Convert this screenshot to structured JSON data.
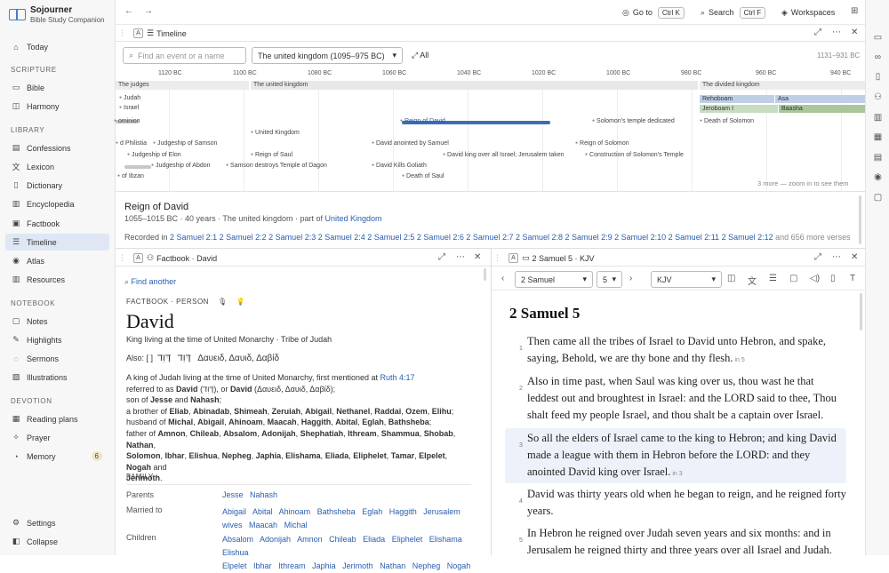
{
  "app": {
    "name": "Sojourner",
    "subtitle": "Bible Study Companion"
  },
  "topbar": {
    "goto_label": "Go to",
    "goto_kbd": "Ctrl K",
    "search_label": "Search",
    "search_kbd": "Ctrl F",
    "workspaces_label": "Workspaces"
  },
  "sidebar": {
    "today": "Today",
    "scripture_head": "SCRIPTURE",
    "bible": "Bible",
    "harmony": "Harmony",
    "library_head": "LIBRARY",
    "confessions": "Confessions",
    "lexicon": "Lexicon",
    "dictionary": "Dictionary",
    "encyclopedia": "Encyclopedia",
    "factbook": "Factbook",
    "timeline": "Timeline",
    "atlas": "Atlas",
    "resources": "Resources",
    "notebook_head": "NOTEBOOK",
    "notes": "Notes",
    "highlights": "Highlights",
    "sermons": "Sermons",
    "illustrations": "Illustrations",
    "devotion_head": "DEVOTION",
    "reading_plans": "Reading plans",
    "prayer": "Prayer",
    "memory": "Memory",
    "memory_count": "6",
    "settings": "Settings",
    "collapse": "Collapse"
  },
  "timeline": {
    "tab_letter": "A",
    "title": "Timeline",
    "search_placeholder": "Find an event or a name",
    "period_select": "The united kingdom (1095–975 BC)",
    "all_label": "All",
    "range": "1131–931 BC",
    "ticks": [
      "1120 BC",
      "1100 BC",
      "1080 BC",
      "1060 BC",
      "1040 BC",
      "1020 BC",
      "1000 BC",
      "980 BC",
      "960 BC",
      "940 BC"
    ],
    "bands": [
      "The judges",
      "The united kingdom",
      "The divided kingdom"
    ],
    "rows": [
      "Judah",
      "Israel"
    ],
    "kings": {
      "rehoboam": "Rehoboam",
      "asa": "Asa",
      "jeroboam": "Jeroboam I",
      "baasha": "Baasha"
    },
    "events": {
      "dominion": "ominion",
      "philistia": "d Philistia",
      "judgeship_samson": "Judgeship of Samson",
      "judgeship_elon": "Judgeship of Elon",
      "judgeship_abdon": "Judgeship of Abdon",
      "ibzan": "of Ibzan",
      "united_kingdom": "United Kingdom",
      "reign_saul": "Reign of Saul",
      "samson_temple": "Samson destroys Temple of Dagon",
      "reign_david": "Reign of David",
      "david_anointed": "David anointed by Samuel",
      "david_kills": "David Kills Goliath",
      "death_saul": "Death of Saul",
      "david_king": "David king over all Israel; Jerusalem taken",
      "solomon_temple": "Solomon's temple dedicated",
      "reign_solomon": "Reign of Solomon",
      "construction": "Construction of Solomon's Temple",
      "death_solomon": "Death of Solomon"
    },
    "more_note": "3 more — zoom in to see them",
    "selected": {
      "title": "Reign of David",
      "meta_prefix": "1055–1015 BC · 40 years · The united kingdom · part of",
      "meta_link": "United Kingdom",
      "recorded_label": "Recorded in",
      "refs": [
        "2 Samuel 2:1",
        "2 Samuel 2:2",
        "2 Samuel 2:3",
        "2 Samuel 2:4",
        "2 Samuel 2:5",
        "2 Samuel 2:6",
        "2 Samuel 2:7",
        "2 Samuel 2:8",
        "2 Samuel 2:9",
        "2 Samuel 2:10",
        "2 Samuel 2:11",
        "2 Samuel 2:12"
      ],
      "more_refs": "and 656 more verses"
    }
  },
  "factbook": {
    "tab_letter": "A",
    "title": "Factbook · David",
    "find_another": "Find another",
    "category": "FACTBOOK · PERSON",
    "name": "David",
    "subtitle": "King living at the time of United Monarchy · Tribe of Judah",
    "also_label": "Also: [ ]",
    "also_hebrew1": "דָּוִד",
    "also_hebrew2": "דָּוִד",
    "also_greek": "Δαυειδ, Δαυιδ, Δαβίδ",
    "desc_prefix": "A king of Judah living at the time of United Monarchy, first mentioned at",
    "desc_link": "Ruth 4:17",
    "referred_prefix": "referred to as",
    "referred_name1": "David",
    "referred_mid": "(דָּוִד), or",
    "referred_name2": "David",
    "referred_greek": "(Δαυειδ, Δαυιδ, Δαβίδ);",
    "son_prefix": "son of",
    "son_1": "Jesse",
    "son_and": "and",
    "son_2": "Nahash",
    "brother_prefix": "a brother of",
    "brothers": [
      "Eliab",
      "Abinadab",
      "Shimeah",
      "Zeruiah",
      "Abigail",
      "Nethanel",
      "Raddai",
      "Ozem",
      "Elihu"
    ],
    "husband_prefix": "husband of",
    "wives": [
      "Michal",
      "Abigail",
      "Ahinoam",
      "Maacah",
      "Haggith",
      "Abital",
      "Eglah",
      "Bathsheba"
    ],
    "father_prefix": "father of",
    "children_line1": [
      "Amnon",
      "Chileab",
      "Absalom",
      "Adonijah",
      "Shephatiah",
      "Ithream",
      "Shammua",
      "Shobab",
      "Nathan"
    ],
    "children_line2": [
      "Solomon",
      "Ibhar",
      "Elishua",
      "Nepheg",
      "Japhia",
      "Elishama",
      "Eliada",
      "Eliphelet",
      "Tamar",
      "Elpelet",
      "Nogah"
    ],
    "children_line3": "Jerimoth",
    "family_head": "FAMILY",
    "parents_label": "Parents",
    "parents": [
      "Jesse",
      "Nahash"
    ],
    "married_label": "Married to",
    "married": [
      "Abigail",
      "Abital",
      "Ahinoam",
      "Bathsheba",
      "Eglah",
      "Haggith",
      "Jerusalem wives",
      "Maacah",
      "Michal"
    ],
    "children_label": "Children",
    "children_a": [
      "Absalom",
      "Adonijah",
      "Amnon",
      "Chileab",
      "Eliada",
      "Eliphelet",
      "Elishama",
      "Elishua"
    ],
    "children_b": [
      "Elpelet",
      "Ibhar",
      "Ithream",
      "Japhia",
      "Jerimoth",
      "Nathan",
      "Nepheg",
      "Nogah"
    ]
  },
  "bible": {
    "tab_letter": "A",
    "title": "2 Samuel 5 · KJV",
    "book_select": "2 Samuel",
    "chapter_select": "5",
    "version_select": "KJV",
    "heading": "2 Samuel 5",
    "verses": [
      {
        "num": "1",
        "text": "Then came all the tribes of Israel to David unto Hebron, and spake, saying, Behold, we are thy bone and thy flesh.",
        "ref": "in 5"
      },
      {
        "num": "2",
        "text": "Also in time past, when Saul was king over us, thou wast he that leddest out and broughtest in Israel: and the LORD said to thee, Thou shalt feed my people Israel, and thou shalt be a captain over Israel.",
        "ref": ""
      },
      {
        "num": "3",
        "text": "So all the elders of Israel came to the king to Hebron; and king David made a league with them in Hebron before the LORD: and they anointed David king over Israel.",
        "ref": "in 3"
      },
      {
        "num": "4",
        "text": "David was thirty years old when he began to reign, and he reigned forty years.",
        "ref": ""
      },
      {
        "num": "5",
        "text": "In Hebron he reigned over Judah seven years and six months: and in Jerusalem he reigned thirty and three years over all Israel and Judah.",
        "ref": ""
      }
    ]
  }
}
